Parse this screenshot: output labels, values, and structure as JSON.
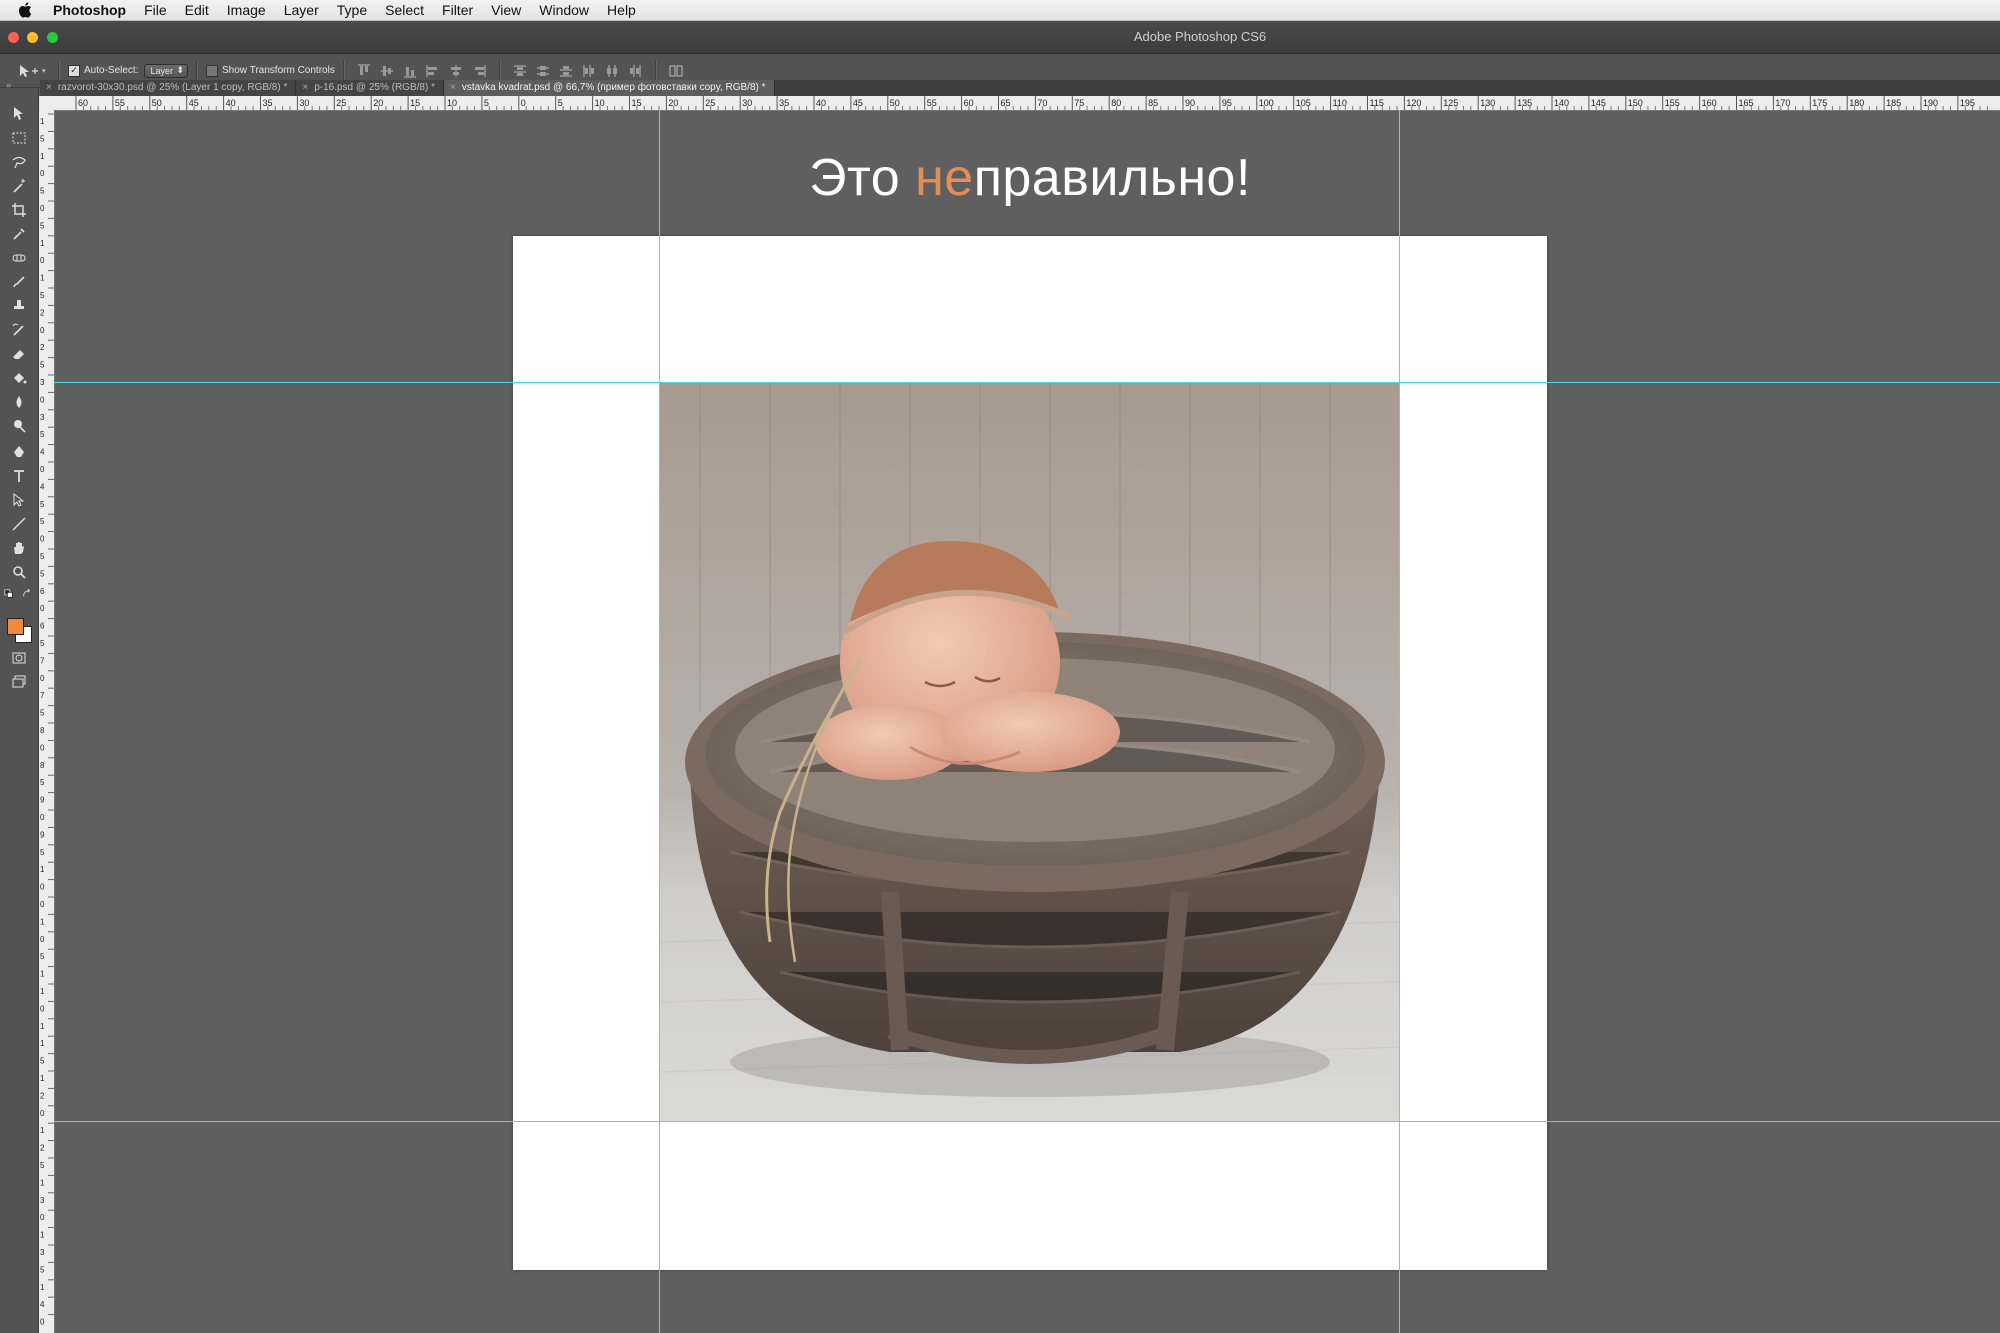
{
  "menubar": {
    "app_name": "Photoshop",
    "items": [
      "File",
      "Edit",
      "Image",
      "Layer",
      "Type",
      "Select",
      "Filter",
      "View",
      "Window",
      "Help"
    ]
  },
  "window": {
    "title": "Adobe Photoshop CS6"
  },
  "options": {
    "auto_select_label": "Auto-Select:",
    "auto_select_checked": true,
    "auto_select_target": "Layer",
    "transform_controls_label": "Show Transform Controls",
    "transform_controls_checked": false
  },
  "tabs": [
    {
      "label": "razvorot-30x30.psd @ 25% (Layer 1 copy, RGB/8) *",
      "active": false
    },
    {
      "label": "p-16.psd @ 25% (RGB/8) *",
      "active": false
    },
    {
      "label": "vstavka kvadrat.psd @ 66,7% (пример фотовставки copy, RGB/8) *",
      "active": true
    }
  ],
  "rulers": {
    "top_labels": [
      "60",
      "55",
      "50",
      "45",
      "40",
      "35",
      "30",
      "25",
      "20",
      "15",
      "10",
      "5",
      "0",
      "5",
      "10",
      "15",
      "20",
      "25",
      "30",
      "35",
      "40",
      "45",
      "50",
      "55",
      "60",
      "65",
      "70",
      "75",
      "80",
      "85",
      "90",
      "95",
      "100",
      "105",
      "110",
      "115",
      "120",
      "125",
      "130",
      "135",
      "140",
      "145",
      "150",
      "155",
      "160",
      "165",
      "170",
      "175",
      "180",
      "185",
      "190",
      "195"
    ],
    "left_labels": [
      "1",
      "5",
      "1",
      "0",
      "5",
      "0",
      "5",
      "1",
      "0",
      "1",
      "5",
      "2",
      "0",
      "2",
      "5",
      "3",
      "0",
      "3",
      "5",
      "4",
      "0",
      "4",
      "5",
      "5",
      "0",
      "5",
      "5",
      "6",
      "0",
      "6",
      "5",
      "7",
      "0",
      "7",
      "5",
      "8",
      "0",
      "8",
      "5",
      "9",
      "0",
      "9",
      "5",
      "1",
      "0",
      "0",
      "1",
      "0",
      "5",
      "1",
      "1",
      "0",
      "1",
      "1",
      "5",
      "1",
      "2",
      "0",
      "1",
      "2",
      "5",
      "1",
      "3",
      "0",
      "1",
      "3",
      "5",
      "1",
      "4",
      "0"
    ]
  },
  "document": {
    "headline_prefix": "Это ",
    "headline_accent": "не",
    "headline_suffix": "правильно!",
    "accent_color": "#e38e58",
    "photo_subject": "newborn-sleeping-in-basket"
  },
  "colors": {
    "foreground": "#f08a3c",
    "background": "#ffffff",
    "guide": "#3fe0e8"
  }
}
